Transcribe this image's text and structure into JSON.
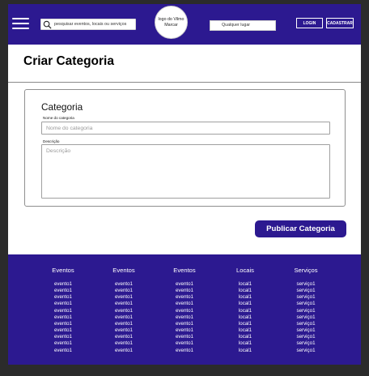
{
  "header": {
    "search_placeholder": "pesquisar eventos, locais ou serviços",
    "logo_text": "logo do Vilmo Marcar",
    "location_text": "Qualquer lugar",
    "login_label": "LOGIN",
    "signup_label": "CADASTRAR"
  },
  "page": {
    "title": "Criar Categoria"
  },
  "form": {
    "heading": "Categoria",
    "name_label": "Nome do categoria",
    "name_placeholder": "Nome do categoria",
    "description_label": "Descrição",
    "description_placeholder": "Descrição",
    "submit_label": "Publicar Categoria"
  },
  "footer": {
    "columns": [
      {
        "heading": "Eventos",
        "items": [
          "evento1",
          "evento1",
          "evento1",
          "evento1",
          "evento1",
          "evento1",
          "evento1",
          "evento1",
          "evento1",
          "evento1",
          "evento1"
        ]
      },
      {
        "heading": "Eventos",
        "items": [
          "evento1",
          "evento1",
          "evento1",
          "evento1",
          "evento1",
          "evento1",
          "evento1",
          "evento1",
          "evento1",
          "evento1",
          "evento1"
        ]
      },
      {
        "heading": "Eventos",
        "items": [
          "evento1",
          "evento1",
          "evento1",
          "evento1",
          "evento1",
          "evento1",
          "evento1",
          "evento1",
          "evento1",
          "evento1",
          "evento1"
        ]
      },
      {
        "heading": "Locais",
        "items": [
          "local1",
          "local1",
          "local1",
          "local1",
          "local1",
          "local1",
          "local1",
          "local1",
          "local1",
          "local1",
          "local1"
        ]
      },
      {
        "heading": "Serviços",
        "items": [
          "serviço1",
          "serviço1",
          "serviço1",
          "serviço1",
          "serviço1",
          "serviço1",
          "serviço1",
          "serviço1",
          "serviço1",
          "serviço1",
          "serviço1"
        ]
      }
    ]
  },
  "icons": {
    "menu": "hamburger-menu-icon",
    "search": "search-icon"
  },
  "colors": {
    "brand": "#2c1990",
    "background": "#2b2b2b",
    "surface": "#ffffff"
  }
}
